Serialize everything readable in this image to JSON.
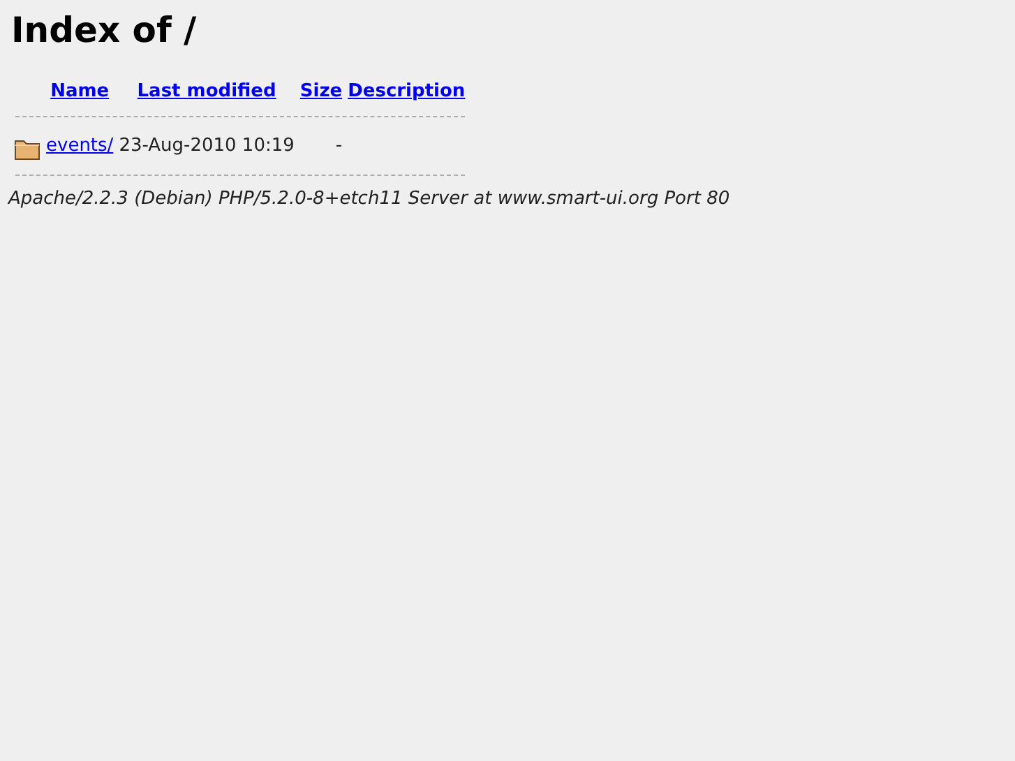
{
  "title": "Index of /",
  "columns": [
    "Name",
    "Last modified",
    "Size",
    "Description"
  ],
  "rows": [
    {
      "kind": "folder",
      "name": "events/",
      "modified": "23-Aug-2010 10:19",
      "size": "-"
    }
  ],
  "footer": "Apache/2.2.3 (Debian) PHP/5.2.0-8+etch11 Server at www.smart-ui.org Port 80"
}
